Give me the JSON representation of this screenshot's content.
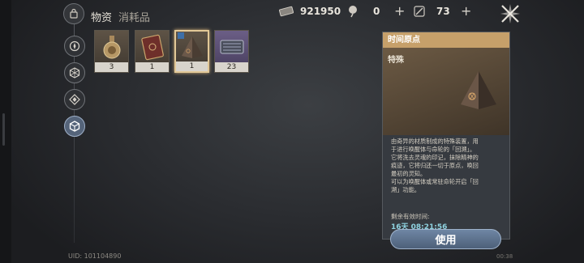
{
  "header": {
    "title": "物资",
    "subtitle": "消耗品",
    "icon": "bag-icon"
  },
  "resources": [
    {
      "icon": "ticket-icon",
      "value": "921950"
    },
    {
      "icon": "pen-icon",
      "value": "0"
    },
    {
      "icon": "quill-icon",
      "value": "73"
    }
  ],
  "nav": [
    {
      "icon": "compass-icon",
      "active": false
    },
    {
      "icon": "hexagon-icon",
      "active": false
    },
    {
      "icon": "diamond-arrow-icon",
      "active": false
    },
    {
      "icon": "cube-icon",
      "active": true
    }
  ],
  "items": [
    {
      "icon": "potion-flask-icon",
      "count": "3",
      "selected": false
    },
    {
      "icon": "book-icon",
      "count": "1",
      "selected": false
    },
    {
      "icon": "pyramid-icon",
      "count": "1",
      "selected": true
    },
    {
      "icon": "crate-icon",
      "count": "23",
      "selected": false
    }
  ],
  "detail": {
    "title": "时间原点",
    "type": "特殊",
    "description_lines": [
      "由奇异的材质制成的特殊装置，用",
      "于进行唤醒体与命轮的「回溯」。",
      "它将洗去灵魂的印记，抹除精神的",
      "痕迹，它将归还一切于原点，唤回",
      "最初的灵知。",
      "可以为唤醒体或常驻命轮开启「回",
      "溯」功能。"
    ],
    "remaining_label": "剩余有效时间:",
    "remaining_value": "16天 08:21:56",
    "use_button": "使用"
  },
  "footer": {
    "uid": "UID: 101104890",
    "time": "00:38"
  },
  "colors": {
    "accent_gold": "#c6a06a",
    "selection_border": "#e2c897",
    "button_blue": "#5d7390",
    "timer_cyan": "#8ed2e0"
  }
}
